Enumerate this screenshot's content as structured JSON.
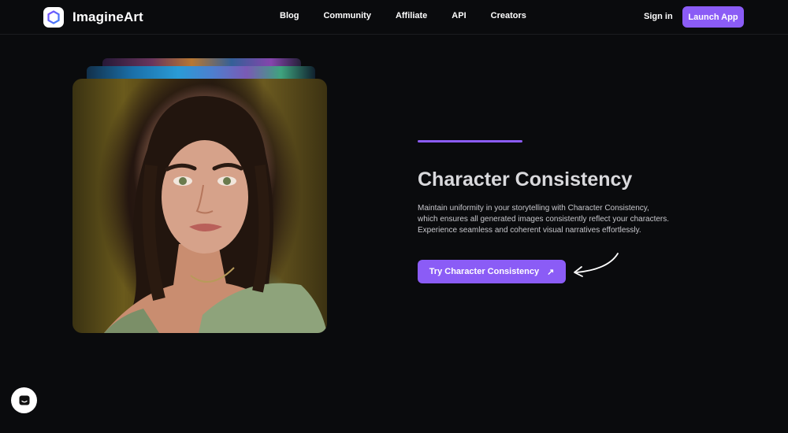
{
  "header": {
    "brand": "ImagineArt",
    "nav": [
      {
        "label": "Blog"
      },
      {
        "label": "Community"
      },
      {
        "label": "Affiliate"
      },
      {
        "label": "API"
      },
      {
        "label": "Creators"
      }
    ],
    "sign_in": "Sign in",
    "launch_app": "Launch App"
  },
  "hero": {
    "title": "Character Consistency",
    "description": "Maintain uniformity in your storytelling with Character Consistency, which ensures all generated images consistently reflect your characters. Experience seamless and coherent visual narratives effortlessly.",
    "cta_label": "Try Character Consistency",
    "cta_icon": "↗",
    "accent_color": "#8b5cf6"
  },
  "icons": {
    "logo": "hexagon-logo-icon",
    "cta": "arrow-up-right-icon",
    "pointer": "curved-arrow-icon",
    "chat": "chat-icon"
  }
}
